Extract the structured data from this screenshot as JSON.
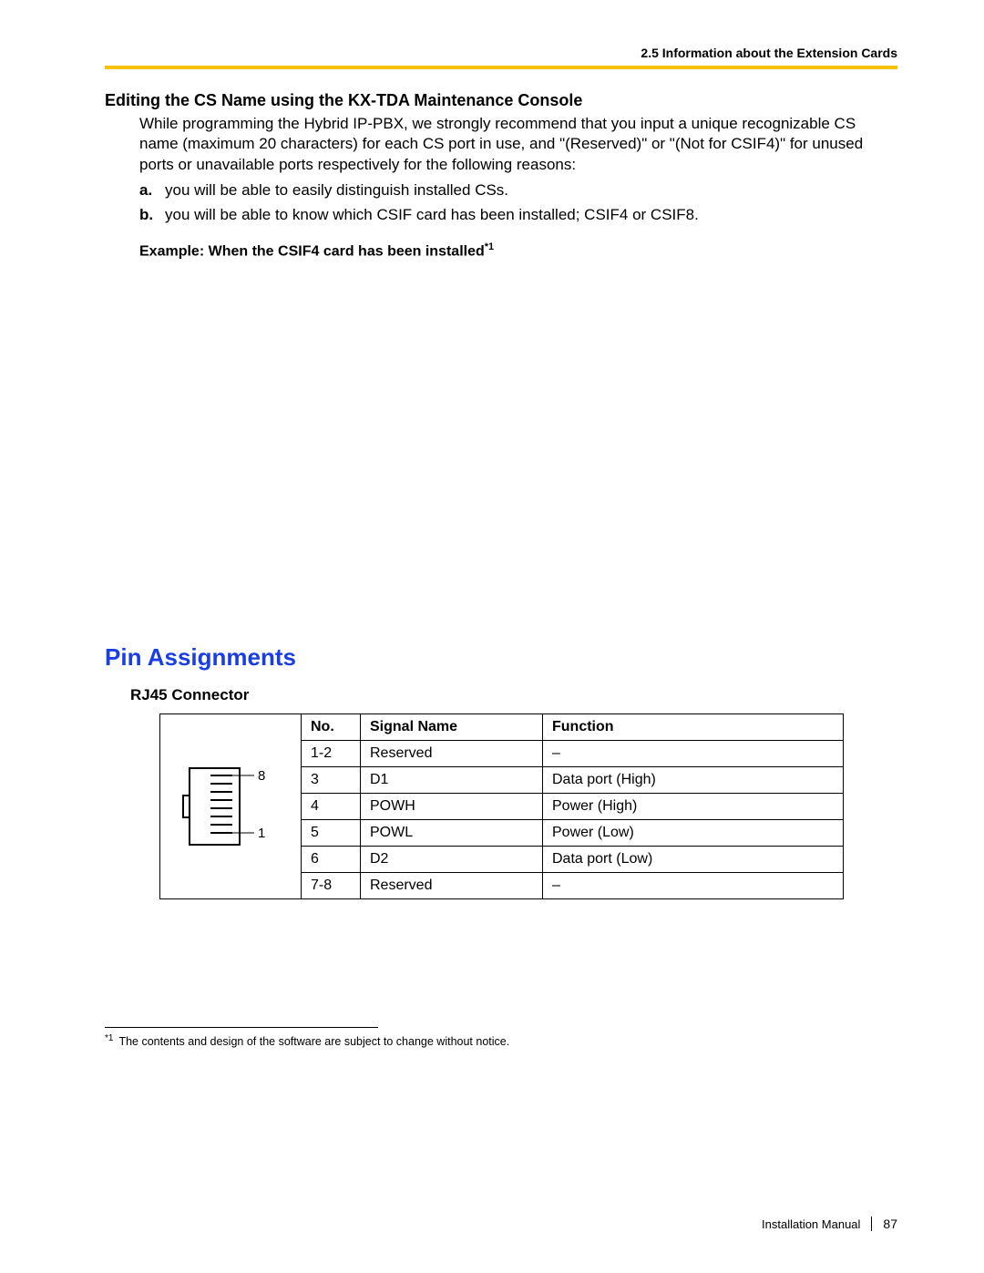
{
  "header": {
    "section_ref": "2.5 Information about the Extension Cards"
  },
  "s1": {
    "heading": "Editing the CS Name using the KX-TDA Maintenance Console",
    "para": "While programming the Hybrid IP-PBX, we strongly recommend that you input a unique recognizable CS name (maximum 20 characters) for each CS port in use, and \"(Reserved)\" or \"(Not for CSIF4)\" for unused ports or unavailable ports respectively for the following reasons:",
    "list": [
      {
        "marker": "a.",
        "text": "you will be able to easily distinguish installed CSs."
      },
      {
        "marker": "b.",
        "text": "you will be able to know which CSIF card has been installed; CSIF4 or CSIF8."
      }
    ],
    "example_prefix": "Example: When the CSIF4 card has been installed",
    "example_sup": "*1"
  },
  "s2": {
    "heading": "Pin Assignments",
    "sub": "RJ45 Connector",
    "connector": {
      "top_label": "8",
      "bottom_label": "1"
    },
    "table": {
      "headers": {
        "no": "No.",
        "signal": "Signal Name",
        "func": "Function"
      },
      "rows": [
        {
          "no": "1-2",
          "signal": "Reserved",
          "func": "–"
        },
        {
          "no": "3",
          "signal": "D1",
          "func": "Data port (High)"
        },
        {
          "no": "4",
          "signal": "POWH",
          "func": "Power (High)"
        },
        {
          "no": "5",
          "signal": "POWL",
          "func": "Power (Low)"
        },
        {
          "no": "6",
          "signal": "D2",
          "func": "Data port (Low)"
        },
        {
          "no": "7-8",
          "signal": "Reserved",
          "func": "–"
        }
      ]
    }
  },
  "footnote": {
    "marker": "*1",
    "text": "The contents and design of the software are subject to change without notice."
  },
  "footer": {
    "manual": "Installation Manual",
    "page": "87"
  }
}
